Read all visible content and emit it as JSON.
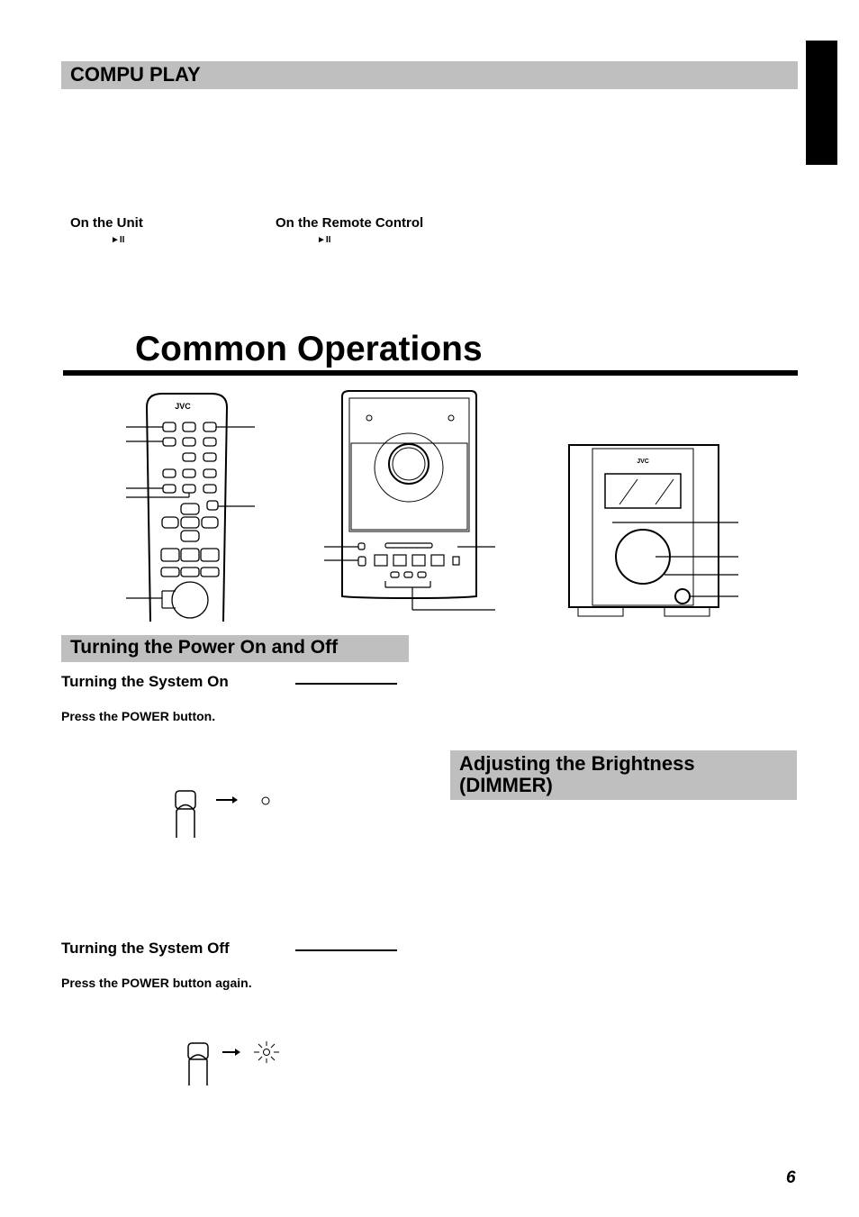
{
  "compu_play": {
    "title": "COMPU PLAY",
    "on_unit": "On the Unit",
    "on_remote": "On the Remote Control",
    "play_pause_symbol": "►II"
  },
  "main_title": "Common Operations",
  "power_section": {
    "title": "Turning the Power On and Off",
    "system_on": {
      "heading": "Turning the System On",
      "instruction": "Press the POWER button."
    },
    "system_off": {
      "heading": "Turning the System Off",
      "instruction": "Press the POWER button again."
    }
  },
  "dimmer_section": {
    "title_line1": "Adjusting the Brightness",
    "title_line2": "(DIMMER)"
  },
  "diagrams": {
    "remote_logo": "JVC",
    "unit_logo": "JVC"
  },
  "page_number": "6",
  "colors": {
    "section_bar": "#bfbfbf",
    "tab": "#000000"
  }
}
